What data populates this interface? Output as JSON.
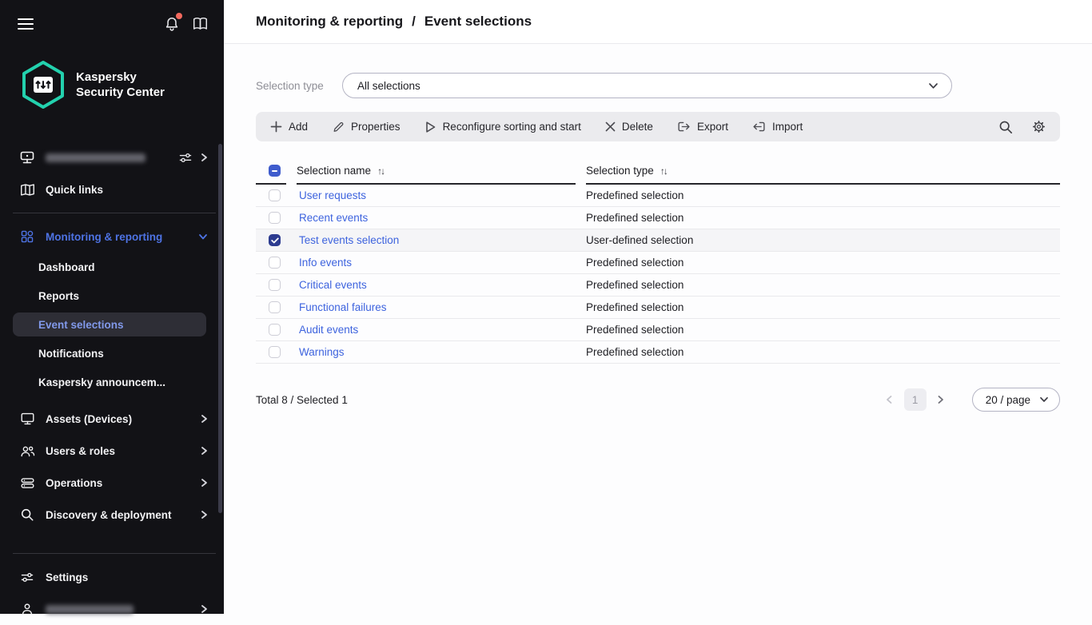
{
  "colors": {
    "brand_teal": "#23D1AE",
    "accent_blue": "#3D63DE",
    "sidebar_bg": "#121216",
    "notification_dot": "#F4695E",
    "indeterminate_checkbox": "#3F5CCD",
    "checked_checkbox": "#2D3C90"
  },
  "brand": {
    "line1": "Kaspersky",
    "line2": "Security Center"
  },
  "sidebar": {
    "items": {
      "quick_links": "Quick links",
      "monitoring": "Monitoring & reporting",
      "dashboard": "Dashboard",
      "reports": "Reports",
      "event_selections": "Event selections",
      "notifications": "Notifications",
      "announcements": "Kaspersky announcem...",
      "assets": "Assets (Devices)",
      "users_roles": "Users & roles",
      "operations": "Operations",
      "discovery": "Discovery & deployment",
      "settings": "Settings"
    }
  },
  "header": {
    "breadcrumb": [
      "Monitoring & reporting",
      "Event selections"
    ],
    "separator": "/"
  },
  "filter": {
    "label": "Selection type",
    "value": "All selections"
  },
  "toolbar": {
    "add": "Add",
    "properties": "Properties",
    "reconfigure": "Reconfigure sorting and start",
    "delete": "Delete",
    "export": "Export",
    "import": "Import"
  },
  "table": {
    "sort_icon": "↑↓",
    "columns": {
      "name": "Selection name",
      "type": "Selection type"
    },
    "select_all_state": "indeterminate",
    "rows": [
      {
        "name": "User requests",
        "type": "Predefined selection",
        "checked": false
      },
      {
        "name": "Recent events",
        "type": "Predefined selection",
        "checked": false
      },
      {
        "name": "Test events selection",
        "type": "User-defined selection",
        "checked": true
      },
      {
        "name": "Info events",
        "type": "Predefined selection",
        "checked": false
      },
      {
        "name": "Critical events",
        "type": "Predefined selection",
        "checked": false
      },
      {
        "name": "Functional failures",
        "type": "Predefined selection",
        "checked": false
      },
      {
        "name": "Audit events",
        "type": "Predefined selection",
        "checked": false
      },
      {
        "name": "Warnings",
        "type": "Predefined selection",
        "checked": false
      }
    ]
  },
  "footer": {
    "summary": "Total 8 / Selected 1"
  },
  "pagination": {
    "current_page": "1",
    "page_size": "20 / page"
  }
}
